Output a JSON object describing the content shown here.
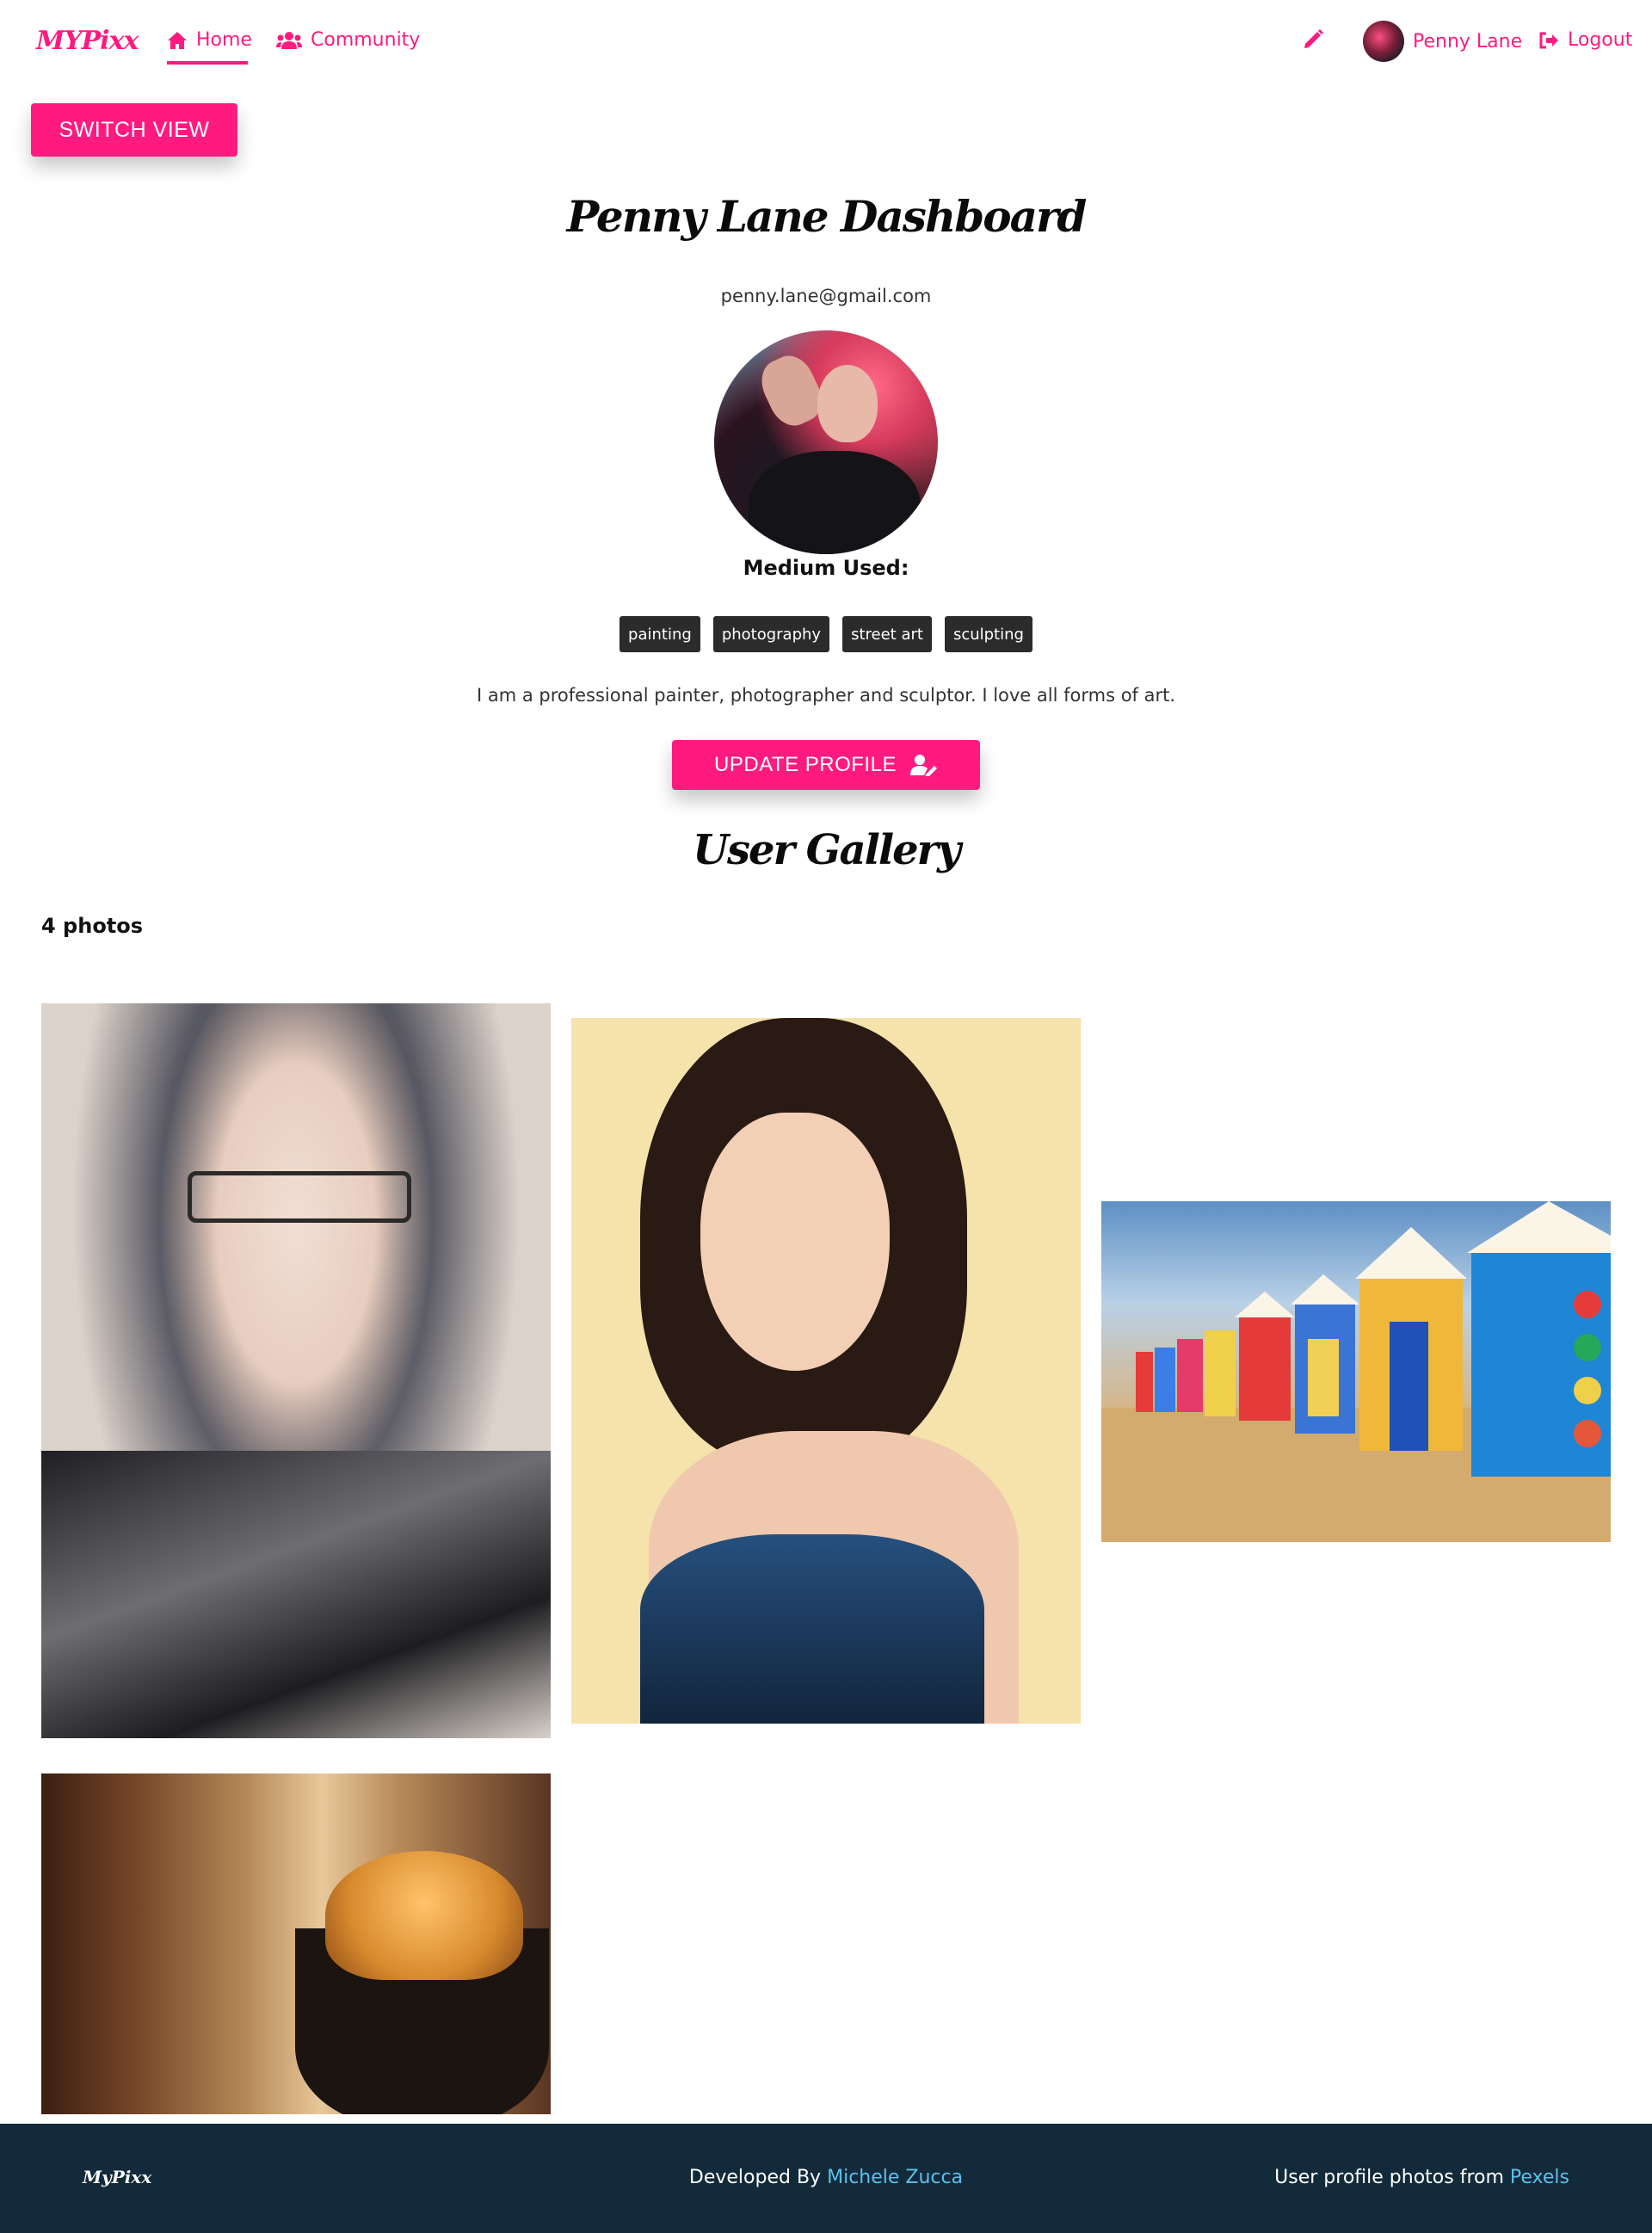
{
  "nav": {
    "brand": "MYPixx",
    "home_label": "Home",
    "community_label": "Community",
    "user_name": "Penny Lane",
    "logout_label": "Logout",
    "icons": {
      "home": "home-icon",
      "community": "users-icon",
      "edit": "pencil-icon",
      "logout": "logout-icon"
    }
  },
  "switch_view_label": "SWITCH VIEW",
  "dashboard": {
    "title": "Penny Lane Dashboard",
    "email": "penny.lane@gmail.com",
    "medium_label": "Medium Used:",
    "tags": [
      "painting",
      "photography",
      "street art",
      "sculpting"
    ],
    "bio": "I am a professional painter, photographer and sculptor. I love all forms of art.",
    "update_label": "UPDATE PROFILE"
  },
  "gallery": {
    "title": "User Gallery",
    "count": "4 photos"
  },
  "footer": {
    "brand": "MyPixx",
    "developed_prefix": "Developed By",
    "developer": "Michele Zucca",
    "credit_prefix": "User profile photos from",
    "credit_source": "Pexels"
  },
  "colors": {
    "accent": "#ff1a7f",
    "footer_bg": "#132a3a",
    "footer_link": "#5bc0eb",
    "tag_bg": "#2b2b2b"
  }
}
